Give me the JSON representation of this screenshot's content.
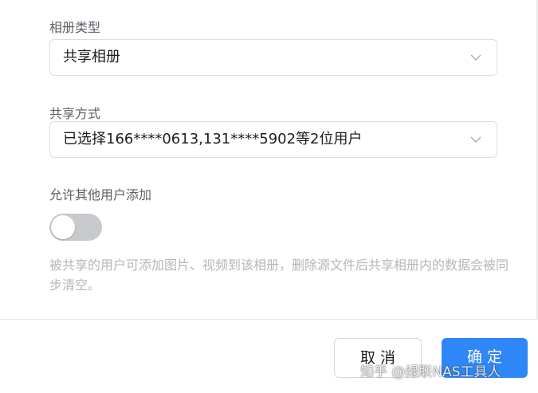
{
  "album_type": {
    "label": "相册类型",
    "value": "共享相册"
  },
  "share_method": {
    "label": "共享方式",
    "value": "已选择166****0613,131****5902等2位用户"
  },
  "allow_add": {
    "label": "允许其他用户添加",
    "enabled": false,
    "hint": "被共享的用户可添加图片、视频到该相册，删除源文件后共享相册内的数据会被同步清空。"
  },
  "footer": {
    "cancel_label": "取 消",
    "ok_label": "确 定"
  },
  "watermark": "知乎 @绿联NAS工具人",
  "colors": {
    "primary": "#2f86f6",
    "toggle_off": "#c8c9cc",
    "hint_text": "#b5b6bb"
  },
  "icons": {
    "select_arrow": "chevron-down-icon"
  }
}
